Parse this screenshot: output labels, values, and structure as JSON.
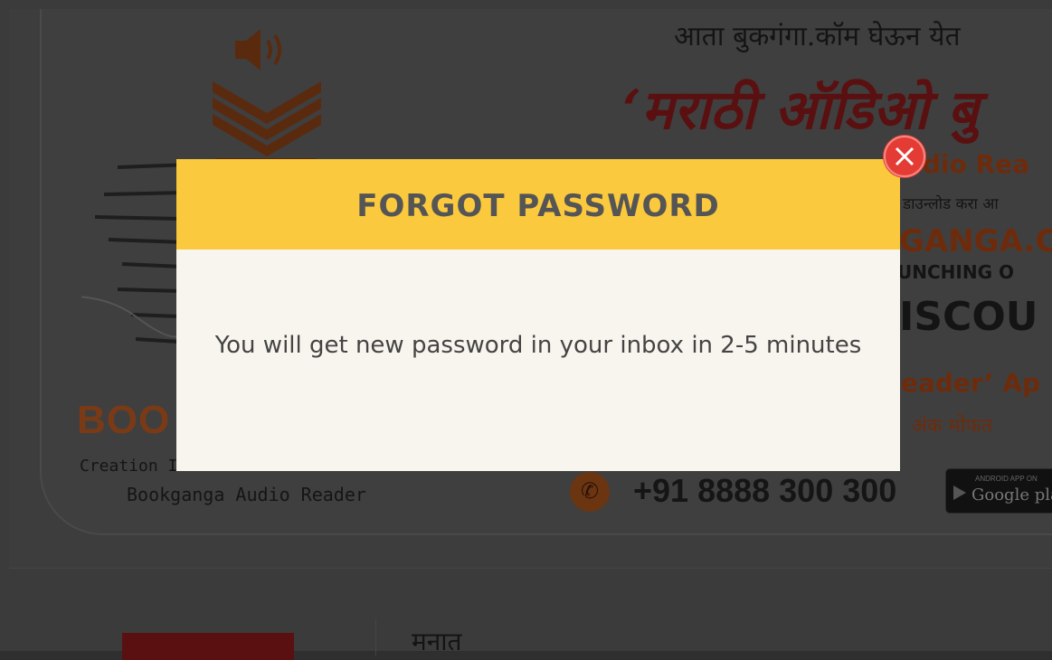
{
  "banner": {
    "marathi_line1": "आता बुकगंगा.कॉम घेऊन येत",
    "marathi_line2": "‘मराठी ऑडिओ बु",
    "app_name_partial": "udio Rea",
    "download_line": "डाउन्लोड करा आ",
    "site_partial": "GANGA.C",
    "launching_partial": "UNCHING O",
    "discount_partial": "ISCOU",
    "reader_app_partial": "eader’ Ap",
    "free_issue_partial": "अंक मोफत",
    "brand_partial": "BOO",
    "brand_tagline_partial": "Creation I",
    "audio_reader": "Bookganga Audio Reader",
    "phone": "+91 8888 300 300",
    "google_play_small": "ANDROID APP ON",
    "google_play_big": "Google pla"
  },
  "below": {
    "heading_partial": "मनात"
  },
  "modal": {
    "title": "FORGOT PASSWORD",
    "message": "You will get new password in your inbox in 2-5 minutes"
  },
  "colors": {
    "header_yellow": "#fbc93e",
    "close_red": "#e53b35",
    "modal_body": "#f8f5ee"
  }
}
